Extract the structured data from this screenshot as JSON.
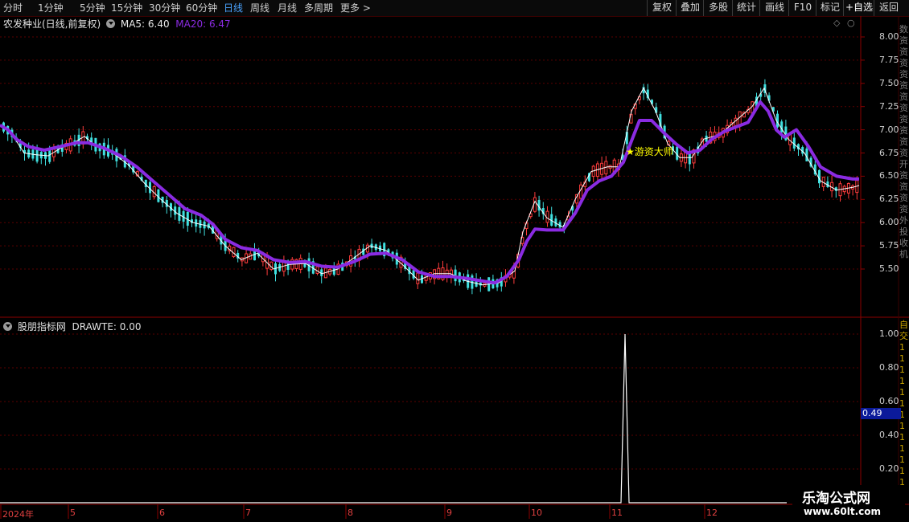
{
  "toolbar": {
    "timeframes": [
      "分时",
      "1分钟",
      "5分钟",
      "15分钟",
      "30分钟",
      "60分钟",
      "日线",
      "周线",
      "月线",
      "多周期",
      "更多"
    ],
    "active_index": 6,
    "buttons": [
      "复权",
      "叠加",
      "多股",
      "统计",
      "画线",
      "F10",
      "标记",
      "+自选",
      "返回"
    ]
  },
  "main_chart": {
    "title": "农发种业(日线,前复权)",
    "ma5_label": "MA5: 6.40",
    "ma20_label": "MA20: 6.47",
    "ma5_color": "#ffffff",
    "ma20_color": "#8a2be2",
    "annotation": "★游资大师",
    "y_ticks": [
      "8.00",
      "7.75",
      "7.50",
      "7.25",
      "7.00",
      "6.75",
      "6.50",
      "6.25",
      "6.00",
      "5.75",
      "5.50"
    ],
    "up_color": "#ff3c3c",
    "down_color": "#40e0e0"
  },
  "sub_chart": {
    "title": "股朋指标网",
    "value_label": "DRAWTE: 0.00",
    "y_ticks": [
      "1.00",
      "0.80",
      "0.60",
      "0.40",
      "0.20"
    ],
    "current_value": "0.49",
    "line_color": "#ffffff"
  },
  "x_axis": {
    "labels": [
      "2024年",
      "5",
      "6",
      "7",
      "8",
      "9",
      "10",
      "11",
      "12"
    ]
  },
  "watermark": {
    "line1": "乐淘公式网",
    "line2": "www.60lt.com"
  },
  "chart_data": {
    "type": "candlestick",
    "ylim": [
      5.2,
      8.05
    ],
    "ma5_current": 6.4,
    "ma20_current": 6.47,
    "ma20_path": [
      [
        0,
        7.05
      ],
      [
        10,
        7.0
      ],
      [
        20,
        6.9
      ],
      [
        35,
        6.82
      ],
      [
        55,
        6.78
      ],
      [
        75,
        6.82
      ],
      [
        95,
        6.86
      ],
      [
        110,
        6.86
      ],
      [
        130,
        6.8
      ],
      [
        150,
        6.72
      ],
      [
        170,
        6.6
      ],
      [
        190,
        6.45
      ],
      [
        210,
        6.3
      ],
      [
        230,
        6.15
      ],
      [
        250,
        6.08
      ],
      [
        265,
        5.98
      ],
      [
        280,
        5.82
      ],
      [
        300,
        5.73
      ],
      [
        320,
        5.7
      ],
      [
        340,
        5.6
      ],
      [
        360,
        5.57
      ],
      [
        380,
        5.58
      ],
      [
        400,
        5.53
      ],
      [
        420,
        5.52
      ],
      [
        440,
        5.58
      ],
      [
        460,
        5.66
      ],
      [
        480,
        5.67
      ],
      [
        500,
        5.6
      ],
      [
        520,
        5.47
      ],
      [
        540,
        5.42
      ],
      [
        560,
        5.42
      ],
      [
        580,
        5.4
      ],
      [
        600,
        5.37
      ],
      [
        615,
        5.35
      ],
      [
        630,
        5.42
      ],
      [
        645,
        5.6
      ],
      [
        655,
        5.8
      ],
      [
        665,
        5.93
      ],
      [
        680,
        5.92
      ],
      [
        700,
        5.92
      ],
      [
        715,
        6.1
      ],
      [
        730,
        6.35
      ],
      [
        745,
        6.45
      ],
      [
        760,
        6.5
      ],
      [
        775,
        6.65
      ],
      [
        785,
        6.88
      ],
      [
        795,
        7.1
      ],
      [
        810,
        7.1
      ],
      [
        825,
        6.97
      ],
      [
        840,
        6.85
      ],
      [
        855,
        6.75
      ],
      [
        870,
        6.78
      ],
      [
        885,
        6.9
      ],
      [
        900,
        6.98
      ],
      [
        915,
        7.03
      ],
      [
        930,
        7.08
      ],
      [
        945,
        7.3
      ],
      [
        955,
        7.2
      ],
      [
        965,
        7.0
      ],
      [
        975,
        6.92
      ],
      [
        990,
        7.0
      ],
      [
        1005,
        6.82
      ],
      [
        1020,
        6.6
      ],
      [
        1040,
        6.5
      ],
      [
        1060,
        6.47
      ],
      [
        1068,
        6.47
      ]
    ],
    "ma5_path": [
      [
        0,
        7.05
      ],
      [
        15,
        6.95
      ],
      [
        30,
        6.75
      ],
      [
        45,
        6.73
      ],
      [
        60,
        6.72
      ],
      [
        75,
        6.8
      ],
      [
        90,
        6.85
      ],
      [
        105,
        6.93
      ],
      [
        120,
        6.82
      ],
      [
        140,
        6.75
      ],
      [
        160,
        6.62
      ],
      [
        180,
        6.42
      ],
      [
        200,
        6.25
      ],
      [
        220,
        6.1
      ],
      [
        240,
        6.0
      ],
      [
        260,
        5.96
      ],
      [
        280,
        5.75
      ],
      [
        300,
        5.6
      ],
      [
        320,
        5.67
      ],
      [
        340,
        5.5
      ],
      [
        360,
        5.55
      ],
      [
        380,
        5.56
      ],
      [
        400,
        5.45
      ],
      [
        420,
        5.5
      ],
      [
        440,
        5.62
      ],
      [
        460,
        5.75
      ],
      [
        480,
        5.7
      ],
      [
        500,
        5.55
      ],
      [
        520,
        5.38
      ],
      [
        540,
        5.45
      ],
      [
        560,
        5.45
      ],
      [
        580,
        5.37
      ],
      [
        600,
        5.33
      ],
      [
        620,
        5.35
      ],
      [
        640,
        5.48
      ],
      [
        650,
        5.9
      ],
      [
        665,
        6.23
      ],
      [
        680,
        6.05
      ],
      [
        700,
        5.95
      ],
      [
        715,
        6.25
      ],
      [
        735,
        6.55
      ],
      [
        755,
        6.6
      ],
      [
        770,
        6.6
      ],
      [
        785,
        7.2
      ],
      [
        800,
        7.45
      ],
      [
        815,
        7.2
      ],
      [
        830,
        6.85
      ],
      [
        845,
        6.7
      ],
      [
        860,
        6.7
      ],
      [
        875,
        6.9
      ],
      [
        895,
        6.95
      ],
      [
        915,
        7.1
      ],
      [
        935,
        7.25
      ],
      [
        950,
        7.45
      ],
      [
        965,
        7.1
      ],
      [
        980,
        6.9
      ],
      [
        1000,
        6.75
      ],
      [
        1020,
        6.45
      ],
      [
        1040,
        6.35
      ],
      [
        1060,
        6.38
      ],
      [
        1068,
        6.4
      ]
    ],
    "drawte_spike": {
      "x_index": 777,
      "value": 1.0,
      "baseline": 0.0
    }
  }
}
